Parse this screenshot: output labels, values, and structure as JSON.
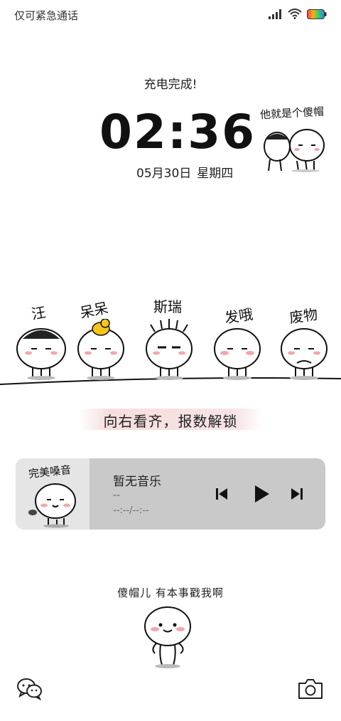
{
  "status_bar": {
    "carrier": "仅可紧急通话",
    "icons": [
      "signal-icon",
      "wifi-icon",
      "battery-icon"
    ]
  },
  "lockscreen": {
    "charge_status": "充电完成!",
    "time": "02:36",
    "date": "05月30日",
    "weekday": "星期四",
    "top_sticker_caption": "他就是个傻帽",
    "characters": [
      {
        "label": "汪"
      },
      {
        "label": "呆呆"
      },
      {
        "label": "斯瑞"
      },
      {
        "label": "发哦"
      },
      {
        "label": "废物"
      }
    ],
    "unlock_hint": "向右看齐，报数解锁",
    "bottom_caption": "傻帽儿 有本事戳我啊"
  },
  "music": {
    "art_caption": "完美嗓音",
    "title": "暂无音乐",
    "artist": "--",
    "time": "--:--/--:--",
    "controls": [
      "previous-icon",
      "play-icon",
      "next-icon"
    ]
  },
  "shortcuts": {
    "left": "wechat-icon",
    "right": "camera-icon"
  },
  "colors": {
    "background": "#ffffff",
    "card": "#c9c9c9",
    "blush": "#f2a7ad",
    "duck": "#f5c518"
  }
}
